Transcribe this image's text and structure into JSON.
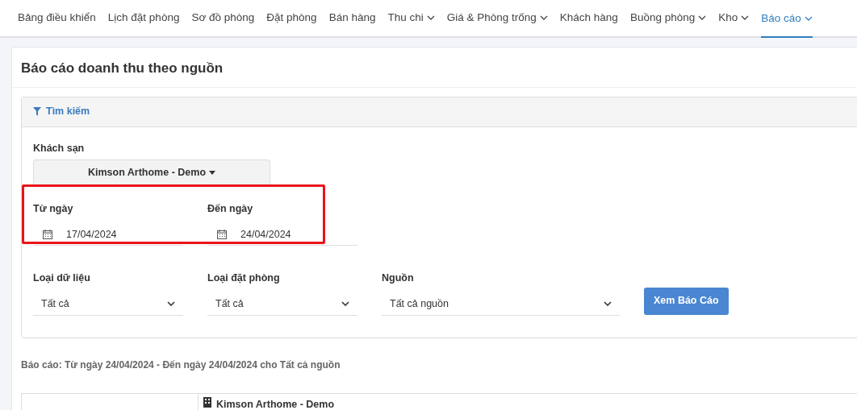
{
  "nav": [
    {
      "label": "Bảng điều khiển",
      "dropdown": false,
      "selected": false
    },
    {
      "label": "Lịch đặt phòng",
      "dropdown": false,
      "selected": false
    },
    {
      "label": "Sơ đồ phòng",
      "dropdown": false,
      "selected": false
    },
    {
      "label": "Đặt phòng",
      "dropdown": false,
      "selected": false
    },
    {
      "label": "Bán hàng",
      "dropdown": false,
      "selected": false
    },
    {
      "label": "Thu chi",
      "dropdown": true,
      "selected": false
    },
    {
      "label": "Giá & Phòng trống",
      "dropdown": true,
      "selected": false
    },
    {
      "label": "Khách hàng",
      "dropdown": false,
      "selected": false
    },
    {
      "label": "Buồng phòng",
      "dropdown": true,
      "selected": false
    },
    {
      "label": "Kho",
      "dropdown": true,
      "selected": false
    },
    {
      "label": "Báo cáo",
      "dropdown": true,
      "selected": true
    }
  ],
  "page_title": "Báo cáo doanh thu theo nguồn",
  "search_panel": {
    "title": "Tìm kiếm",
    "hotel": {
      "label": "Khách sạn",
      "value": "Kimson Arthome - Demo"
    },
    "date_fields": [
      {
        "label": "Từ ngày",
        "value": "17/04/2024"
      },
      {
        "label": "Đến ngày",
        "value": "24/04/2024"
      }
    ],
    "selects": [
      {
        "label": "Loại dữ liệu",
        "value": "Tất cả"
      },
      {
        "label": "Loại đặt phòng",
        "value": "Tất cả"
      },
      {
        "label": "Nguồn",
        "value": "Tất cả nguồn"
      }
    ],
    "button": "Xem Báo Cáo"
  },
  "report_summary": "Báo cáo: Từ ngày 24/04/2024 - Đến ngày 24/04/2024 cho Tất cả nguồn",
  "table": {
    "hotel_header": "Kimson Arthome - Demo"
  }
}
